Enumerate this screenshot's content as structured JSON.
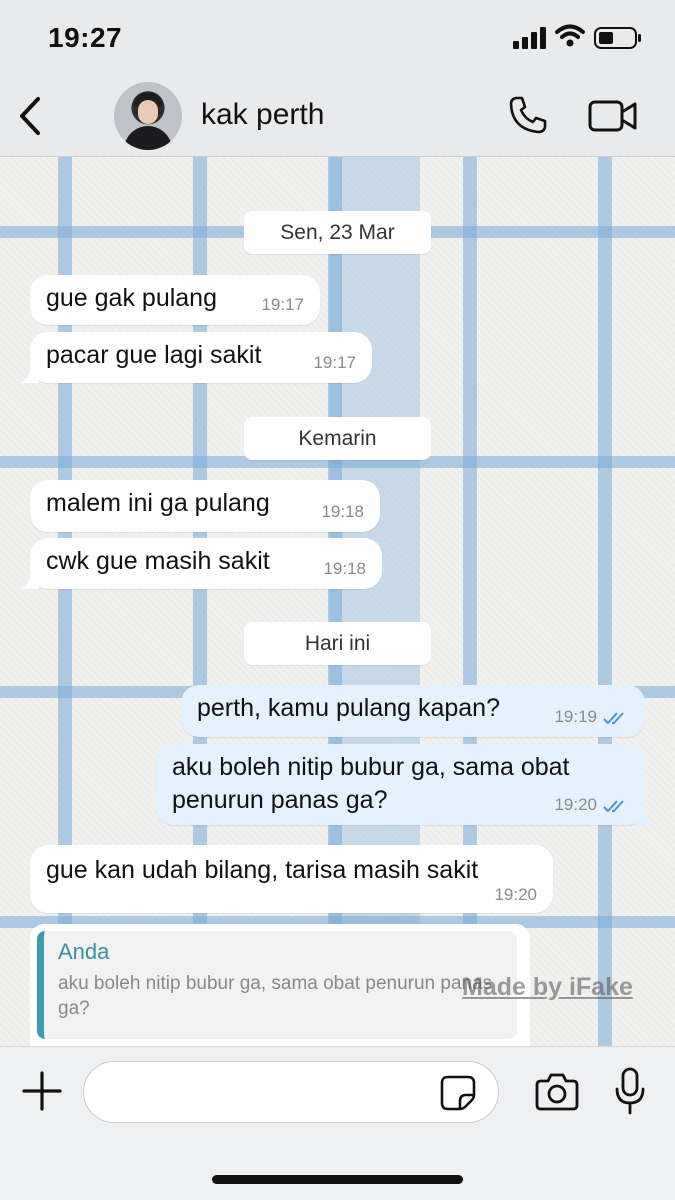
{
  "status_bar": {
    "time": "19:27"
  },
  "header": {
    "contact_name": "kak perth"
  },
  "dates": {
    "d1": "Sen, 23 Mar",
    "d2": "Kemarin",
    "d3": "Hari ini"
  },
  "messages": [
    {
      "text": "gue gak pulang",
      "time": "19:17",
      "direction": "in"
    },
    {
      "text": "pacar gue lagi sakit",
      "time": "19:17",
      "direction": "in"
    },
    {
      "text": "malem ini ga pulang",
      "time": "19:18",
      "direction": "in"
    },
    {
      "text": "cwk gue masih sakit",
      "time": "19:18",
      "direction": "in"
    },
    {
      "text": "perth, kamu pulang kapan?",
      "time": "19:19",
      "direction": "out",
      "status": "read"
    },
    {
      "text": "aku boleh nitip bubur ga, sama obat penurun panas ga?",
      "time": "19:20",
      "direction": "out",
      "status": "read"
    },
    {
      "text": "gue kan udah bilang, tarisa masih sakit",
      "time": "19:20",
      "direction": "in"
    }
  ],
  "reply_quote": {
    "author": "Anda",
    "text": "aku boleh nitip bubur ga, sama obat penurun panas ga?"
  },
  "watermark": "Made by iFake",
  "input": {
    "placeholder": ""
  },
  "icons": {
    "back": "chevron-left-icon",
    "call": "phone-icon",
    "video": "video-camera-icon",
    "plus": "plus-icon",
    "sticker": "sticker-icon",
    "camera": "camera-icon",
    "mic": "microphone-icon"
  },
  "colors": {
    "outgoing_bubble": "#e5f2fd",
    "incoming_bubble": "#ffffff",
    "read_ticks": "#4a90d9",
    "quote_bar": "#3a9db0"
  }
}
